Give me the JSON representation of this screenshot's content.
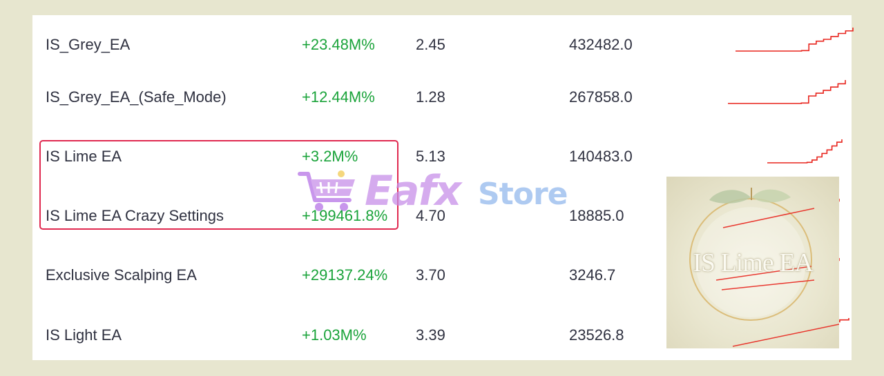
{
  "table": {
    "rows": [
      {
        "name": "IS_Grey_EA",
        "gain": "+23.48M%",
        "pf": "2.45",
        "value": "432482.0",
        "trend": [
          0,
          0,
          0,
          0,
          0,
          0,
          0,
          0,
          0,
          0.02,
          0.3,
          0.42,
          0.5,
          0.62,
          0.75,
          0.86,
          1
        ]
      },
      {
        "name": "IS_Grey_EA_(Safe_Mode)",
        "gain": "+12.44M%",
        "pf": "1.28",
        "value": "267858.0",
        "trend": [
          0,
          0,
          0,
          0,
          0,
          0,
          0,
          0,
          0,
          0,
          0.02,
          0.32,
          0.44,
          0.56,
          0.7,
          0.84,
          1
        ]
      },
      {
        "name": "IS Lime EA",
        "gain": "+3.2M%",
        "pf": "5.13",
        "value": "140483.0",
        "trend": [
          0,
          0,
          0,
          0,
          0,
          0,
          0,
          0,
          0.02,
          0.12,
          0.25,
          0.4,
          0.55,
          0.72,
          0.88,
          1
        ]
      },
      {
        "name": "IS Lime EA Crazy Settings",
        "gain": "+199461.8%",
        "pf": "4.70",
        "value": "18885.0",
        "trend": [
          0,
          0.05,
          0.1,
          0.18,
          0.25,
          0.34,
          0.42,
          0.5,
          0.58,
          0.65,
          0.74,
          0.82,
          0.9,
          1
        ]
      },
      {
        "name": "Exclusive Scalping EA",
        "gain": "+29137.24%",
        "pf": "3.70",
        "value": "3246.7",
        "trend": [
          0,
          0.04,
          0.1,
          0.15,
          0.22,
          0.3,
          0.38,
          0.45,
          0.52,
          0.6,
          0.7,
          0.8,
          0.9,
          1
        ]
      },
      {
        "name": "IS Light EA",
        "gain": "+1.03M%",
        "pf": "3.39",
        "value": "23526.8",
        "trend": [
          0,
          0.05,
          0.12,
          0.2,
          0.28,
          0.36,
          0.44,
          0.52,
          0.6,
          0.68,
          0.76,
          0.84,
          0.92,
          1
        ]
      }
    ]
  },
  "thumbnail": {
    "caption": "IS Lime EA"
  },
  "watermark": {
    "brand_a": "Eafx",
    "brand_b": "Store",
    "icon": "cart-icon"
  },
  "colors": {
    "gain_green": "#1aa33a",
    "highlight_border": "#e0284f",
    "sparkline": "#e8231c",
    "background": "#e7e6cf"
  }
}
